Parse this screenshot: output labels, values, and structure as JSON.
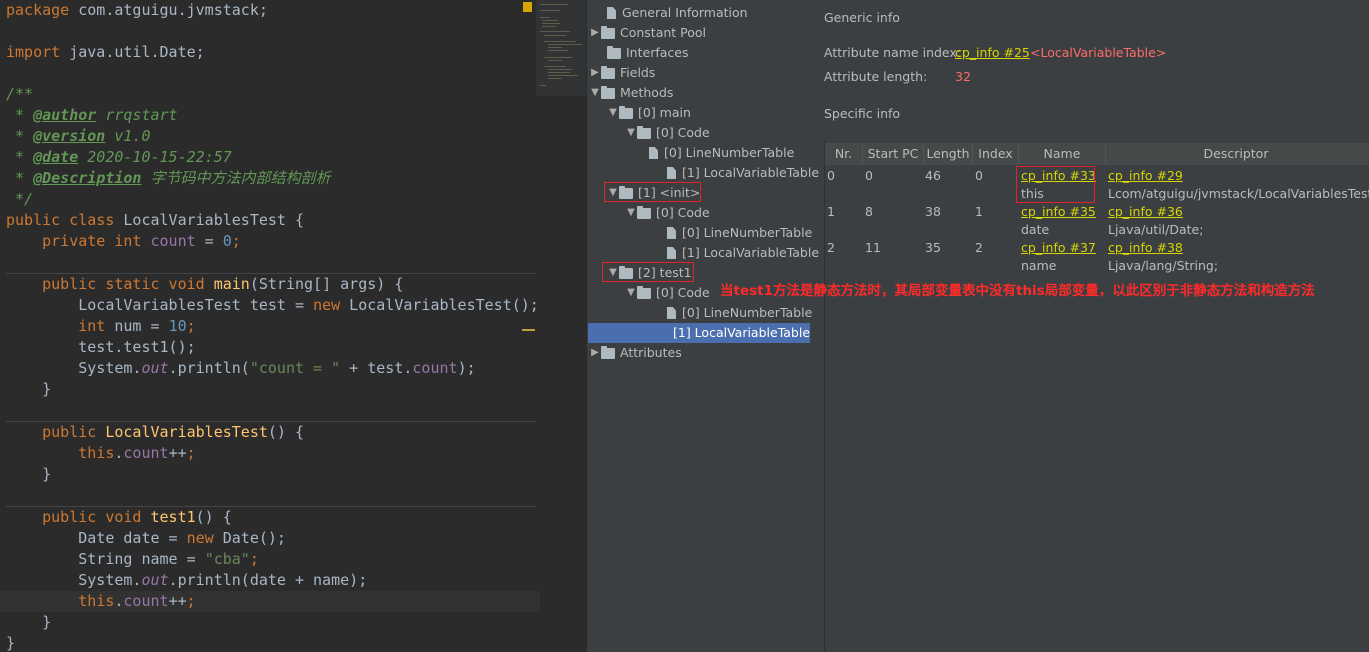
{
  "code": {
    "package_kw": "package",
    "package_name": " com.atguigu.jvmstack;",
    "import_kw": "import",
    "import_name": " java.util.Date;",
    "doc_open": "/**",
    "author_tag": "@author",
    "author_val": " rrqstart",
    "version_tag": "@version",
    "version_val": " v1.0",
    "date_tag": "@date",
    "date_val": " 2020-10-15-22:57",
    "desc_tag": "@Description",
    "desc_val": " 字节码中方法内部结构剖析",
    "doc_close": " */",
    "class_decl_kw": "public class",
    "class_name": " LocalVariablesTest {",
    "field_kw": "private int",
    "field_name": "count",
    "field_val": "0",
    "main_kw": "public static void",
    "main_name": "main",
    "main_params": "(String[] args) {",
    "main_l1a": "LocalVariablesTest test = ",
    "new_kw": "new",
    "main_l1b": " LocalVariablesTest();",
    "int_kw": "int",
    "num_name": " num = ",
    "num_val": "10",
    "main_l3": "test.test1();",
    "println_a": "System.",
    "out": "out",
    "println_b": ".println(",
    "count_str": "\"count = \"",
    "println_c": " + test.",
    "count_ref": "count",
    "println_d": ");",
    "ctor_kw": "public",
    "ctor_name": "LocalVariablesTest",
    "ctor_params": "() {",
    "this_kw": "this",
    "count_inc": "count",
    "test1_kw": "public void",
    "test1_name": "test1",
    "test1_params": "() {",
    "date_decl": "Date date = ",
    "date_new": " Date();",
    "name_decl": "String name = ",
    "name_str": "\"cba\"",
    "println_date": ".println(date + name);",
    "close_brace": "}"
  },
  "tree": {
    "items": [
      {
        "label": "General Information"
      },
      {
        "label": "Constant Pool"
      },
      {
        "label": "Interfaces"
      },
      {
        "label": "Fields"
      },
      {
        "label": "Methods"
      },
      {
        "label": "[0] main"
      },
      {
        "label": "[0] Code"
      },
      {
        "label": "[0] LineNumberTable"
      },
      {
        "label": "[1] LocalVariableTable"
      },
      {
        "label": "[1] <init>"
      },
      {
        "label": "[0] Code"
      },
      {
        "label": "[0] LineNumberTable"
      },
      {
        "label": "[1] LocalVariableTable"
      },
      {
        "label": "[2] test1"
      },
      {
        "label": "[0] Code"
      },
      {
        "label": "[0] LineNumberTable"
      },
      {
        "label": "[1] LocalVariableTable"
      },
      {
        "label": "Attributes"
      }
    ]
  },
  "detail": {
    "generic_title": "Generic info",
    "name_index_label": "Attribute name index:",
    "name_index_link": "cp_info #25",
    "name_index_ref": "<LocalVariableTable>",
    "length_label": "Attribute length:",
    "length_val": "32",
    "specific_title": "Specific info",
    "columns": [
      "Nr.",
      "Start PC",
      "Length",
      "Index",
      "Name",
      "Descriptor"
    ],
    "rows": [
      {
        "nr": "0",
        "start": "0",
        "length": "46",
        "index": "0",
        "name_link": "cp_info #33",
        "name": "this",
        "desc_link": "cp_info #29",
        "desc": "Lcom/atguigu/jvmstack/LocalVariablesTest;"
      },
      {
        "nr": "1",
        "start": "8",
        "length": "38",
        "index": "1",
        "name_link": "cp_info #35",
        "name": "date",
        "desc_link": "cp_info #36",
        "desc": "Ljava/util/Date;"
      },
      {
        "nr": "2",
        "start": "11",
        "length": "35",
        "index": "2",
        "name_link": "cp_info #37",
        "name": "name",
        "desc_link": "cp_info #38",
        "desc": "Ljava/lang/String;"
      }
    ]
  },
  "annotation": "当test1方法是静态方法时，其局部变量表中没有this局部变量，以此区别于非静态方法和构造方法",
  "colors": {
    "editor_bg": "#2b2b2b",
    "panel_bg": "#3c3f41",
    "selection": "#4b6eaf",
    "link": "#d6d605",
    "annotation_red": "#ff2a2a"
  }
}
